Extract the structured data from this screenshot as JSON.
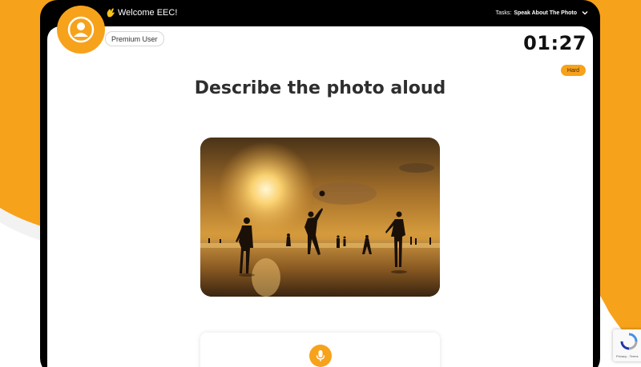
{
  "header": {
    "welcome": "Welcome EEC!",
    "tasks_label": "Tasks:",
    "tasks_value": "Speak About The Photo"
  },
  "user": {
    "badge": "Premium User"
  },
  "timer": "01:27",
  "difficulty": "Hard",
  "title": "Describe the photo aloud",
  "recaptcha": {
    "text": "Privacy - Terms"
  },
  "colors": {
    "accent": "#f7a21b",
    "device": "#000000"
  },
  "icons": {
    "avatar": "user-avatar-icon",
    "welcome": "waving-hand-icon",
    "tasks": "chevron-down-icon",
    "mic": "microphone-icon"
  }
}
